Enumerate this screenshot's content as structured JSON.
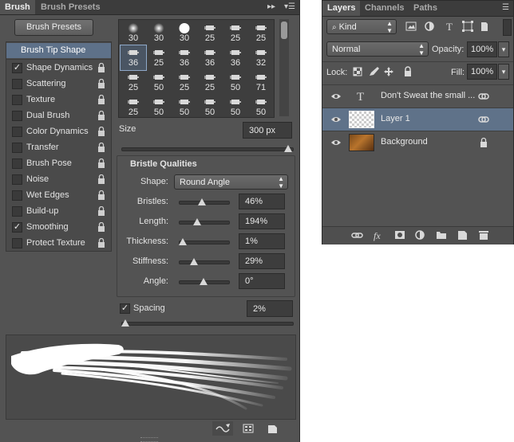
{
  "brush_panel": {
    "tabs": [
      "Brush",
      "Brush Presets"
    ],
    "presets_button": "Brush Presets",
    "options": [
      {
        "label": "Brush Tip Shape",
        "selected": true,
        "checkbox": false,
        "checked": false,
        "lock": false
      },
      {
        "label": "Shape Dynamics",
        "selected": false,
        "checkbox": true,
        "checked": true,
        "lock": true
      },
      {
        "label": "Scattering",
        "selected": false,
        "checkbox": true,
        "checked": false,
        "lock": true
      },
      {
        "label": "Texture",
        "selected": false,
        "checkbox": true,
        "checked": false,
        "lock": true
      },
      {
        "label": "Dual Brush",
        "selected": false,
        "checkbox": true,
        "checked": false,
        "lock": true
      },
      {
        "label": "Color Dynamics",
        "selected": false,
        "checkbox": true,
        "checked": false,
        "lock": true
      },
      {
        "label": "Transfer",
        "selected": false,
        "checkbox": true,
        "checked": false,
        "lock": true
      },
      {
        "label": "Brush Pose",
        "selected": false,
        "checkbox": true,
        "checked": false,
        "lock": true
      },
      {
        "label": "Noise",
        "selected": false,
        "checkbox": true,
        "checked": false,
        "lock": true
      },
      {
        "label": "Wet Edges",
        "selected": false,
        "checkbox": true,
        "checked": false,
        "lock": true
      },
      {
        "label": "Build-up",
        "selected": false,
        "checkbox": true,
        "checked": false,
        "lock": true
      },
      {
        "label": "Smoothing",
        "selected": false,
        "checkbox": true,
        "checked": true,
        "lock": true
      },
      {
        "label": "Protect Texture",
        "selected": false,
        "checkbox": true,
        "checked": false,
        "lock": true
      }
    ],
    "tip_grid": [
      [
        "30",
        "30",
        "30",
        "25",
        "25",
        "25"
      ],
      [
        "36",
        "25",
        "36",
        "36",
        "36",
        "32"
      ],
      [
        "25",
        "50",
        "25",
        "25",
        "50",
        "71"
      ],
      [
        "25",
        "50",
        "50",
        "50",
        "50",
        "50"
      ]
    ],
    "selected_tip": {
      "row": 1,
      "col": 0
    },
    "size_label": "Size",
    "size_value": "300 px",
    "size_level": 1.0,
    "bristle_qualities": {
      "title": "Bristle Qualities",
      "shape_label": "Shape:",
      "shape_value": "Round Angle",
      "params": [
        {
          "label": "Bristles:",
          "value": "46%",
          "level": 0.46
        },
        {
          "label": "Length:",
          "value": "194%",
          "level": 0.35
        },
        {
          "label": "Thickness:",
          "value": "1%",
          "level": 0.0
        },
        {
          "label": "Stiffness:",
          "value": "29%",
          "level": 0.27
        },
        {
          "label": "Angle:",
          "value": "0°",
          "level": 0.5
        }
      ]
    },
    "spacing_label": "Spacing",
    "spacing_checked": true,
    "spacing_value": "2%",
    "spacing_level": 0.0
  },
  "layers_panel": {
    "tabs": [
      "Layers",
      "Channels",
      "Paths"
    ],
    "filter_kind": "Kind",
    "blend_mode": "Normal",
    "opacity_label": "Opacity:",
    "opacity_value": "100%",
    "lock_label": "Lock:",
    "fill_label": "Fill:",
    "fill_value": "100%",
    "layers": [
      {
        "name": "Don't Sweat the small ...",
        "type": "text",
        "selected": false,
        "right_icon": "link-icon"
      },
      {
        "name": "Layer 1",
        "type": "transparent",
        "selected": true,
        "right_icon": "link-icon"
      },
      {
        "name": "Background",
        "type": "image",
        "selected": false,
        "right_icon": "lock-icon"
      }
    ],
    "footer_icons": [
      "link-layers-icon",
      "fx-icon",
      "layer-mask-icon",
      "adjustment-layer-icon",
      "new-group-icon",
      "new-layer-icon",
      "trash-icon"
    ]
  },
  "colors": {
    "panel_bg": "#535353",
    "selected": "#5e7189",
    "field_bg": "#3d3d3d"
  }
}
